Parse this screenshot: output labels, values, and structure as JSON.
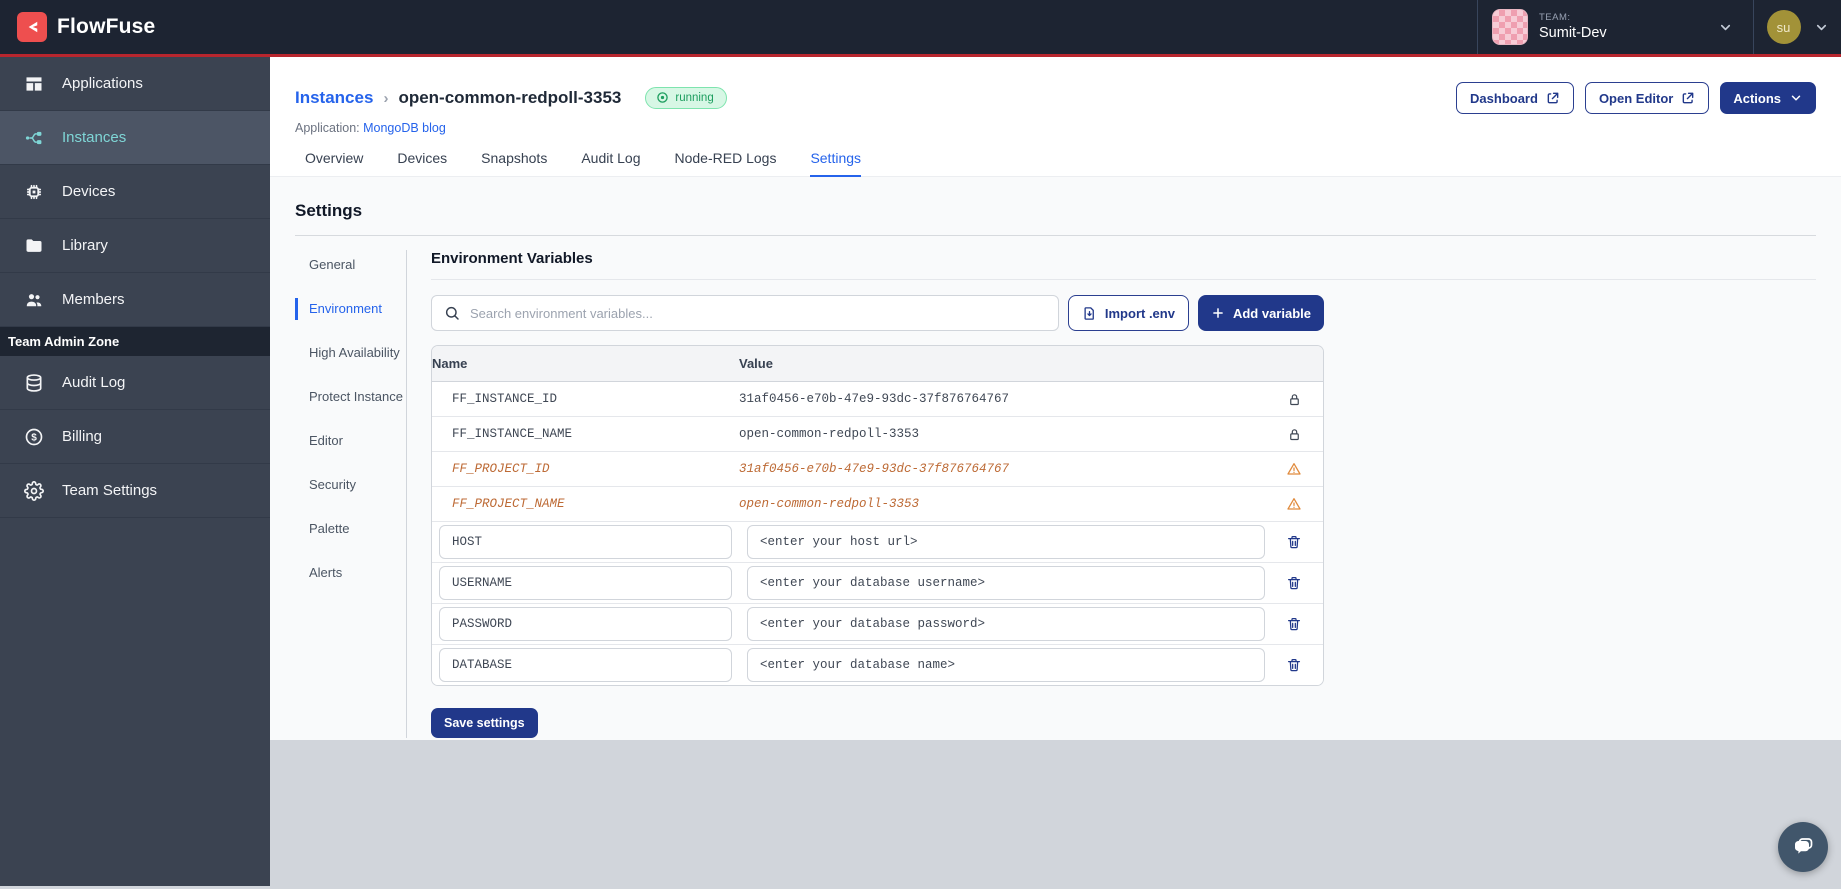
{
  "navbar": {
    "brand": "FlowFuse",
    "team_label": "TEAM:",
    "team_name": "Sumit-Dev",
    "user_initials": "su"
  },
  "sidebar": {
    "items": [
      {
        "label": "Applications"
      },
      {
        "label": "Instances"
      },
      {
        "label": "Devices"
      },
      {
        "label": "Library"
      },
      {
        "label": "Members"
      }
    ],
    "admin_zone_label": "Team Admin Zone",
    "admin_items": [
      {
        "label": "Audit Log"
      },
      {
        "label": "Billing"
      },
      {
        "label": "Team Settings"
      }
    ]
  },
  "header": {
    "breadcrumb_parent": "Instances",
    "breadcrumb_separator": "›",
    "instance_name": "open-common-redpoll-3353",
    "status": "running",
    "application_label": "Application:",
    "application_name": "MongoDB blog",
    "dashboard_button": "Dashboard",
    "open_editor_button": "Open Editor",
    "actions_button": "Actions",
    "tabs": [
      {
        "label": "Overview"
      },
      {
        "label": "Devices"
      },
      {
        "label": "Snapshots"
      },
      {
        "label": "Audit Log"
      },
      {
        "label": "Node-RED Logs"
      },
      {
        "label": "Settings"
      }
    ]
  },
  "settings": {
    "title": "Settings",
    "nav": [
      {
        "label": "General"
      },
      {
        "label": "Environment"
      },
      {
        "label": "High Availability"
      },
      {
        "label": "Protect Instance"
      },
      {
        "label": "Editor"
      },
      {
        "label": "Security"
      },
      {
        "label": "Palette"
      },
      {
        "label": "Alerts"
      }
    ],
    "section_title": "Environment Variables",
    "search_placeholder": "Search environment variables...",
    "import_button": "Import .env",
    "add_button": "Add variable",
    "table": {
      "columns": {
        "name": "Name",
        "value": "Value"
      },
      "locked_rows": [
        {
          "name": "FF_INSTANCE_ID",
          "value": "31af0456-e70b-47e9-93dc-37f876764767"
        },
        {
          "name": "FF_INSTANCE_NAME",
          "value": "open-common-redpoll-3353"
        }
      ],
      "deprecated_rows": [
        {
          "name": "FF_PROJECT_ID",
          "value": "31af0456-e70b-47e9-93dc-37f876764767"
        },
        {
          "name": "FF_PROJECT_NAME",
          "value": "open-common-redpoll-3353"
        }
      ],
      "editable_rows": [
        {
          "name": "HOST",
          "value": "<enter your host url>"
        },
        {
          "name": "USERNAME",
          "value": "<enter your database username>"
        },
        {
          "name": "PASSWORD",
          "value": "<enter your database password>"
        },
        {
          "name": "DATABASE",
          "value": "<enter your database name>"
        }
      ]
    },
    "save_button": "Save settings"
  },
  "colors": {
    "primary_navy": "#21388a",
    "link_blue": "#2563eb",
    "brand_red": "#ee4f4f",
    "navbar_red_line": "#b8262e",
    "sidebar_bg": "#3b4351",
    "sidebar_active_text": "#7fd6d6",
    "running_green_text": "#1d9e5f",
    "running_green_bg": "#d7f7e5",
    "deprecated_orange": "#bd6a35"
  }
}
